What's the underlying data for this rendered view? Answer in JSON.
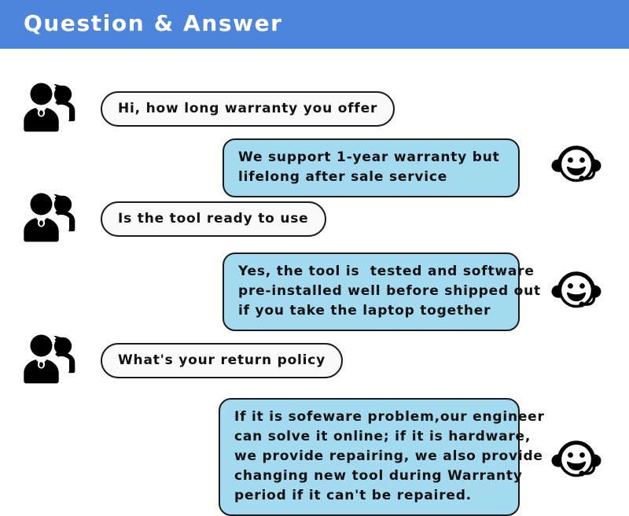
{
  "header": {
    "title": "Question & Answer",
    "background_color": "#4d85dc",
    "text_color": "#ffffff"
  },
  "theme": {
    "answer_bubble_color": "#a3daef",
    "question_bubble_color": "#fafafa",
    "outline_color": "#1b1b1b",
    "page_background": "#ffffff"
  },
  "icons": {
    "user_avatar": "user-group-icon",
    "agent_avatar": "headset-smiley-icon"
  },
  "conversation": [
    {
      "question": "Hi, how long warranty you offer",
      "answer": "We support 1-year warranty but\nlifelong after sale service"
    },
    {
      "question": "Is the tool ready to use",
      "answer": "Yes, the tool is  tested and software\npre-installed well before shipped out\nif you take the laptop together"
    },
    {
      "question": "What's your return policy",
      "answer": "If it is sofeware problem,our engineer\ncan solve it online; if it is hardware,\nwe provide repairing, we also provide\nchanging new tool during Warranty\nperiod if it can't be repaired."
    }
  ]
}
